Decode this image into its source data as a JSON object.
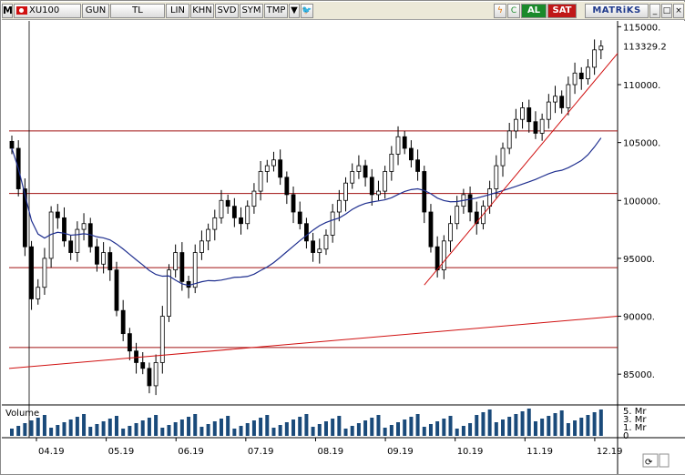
{
  "toolbar": {
    "logo": "M",
    "symbol": "XU100",
    "period": "GUN",
    "currency": "TL",
    "scale_lin": "LIN",
    "btn_khn": "KHN",
    "btn_svd": "SVD",
    "btn_sym": "SYM",
    "btn_tmp": "TMP",
    "buy": "AL",
    "sell": "SAT",
    "brand": "MATRiKS"
  },
  "colors": {
    "candle": "#000000",
    "ma_line": "#1f2f8f",
    "support_lines": "#a01010",
    "trend_line": "#d01010",
    "volume_bars": "#1a4a7a"
  },
  "chart_data": {
    "type": "candlestick",
    "last_price": "113329.2",
    "y_ticks": [
      "115000.",
      "110000.",
      "105000.",
      "100000.",
      "95000.",
      "90000.",
      "85000."
    ],
    "y_values": [
      115000,
      110000,
      105000,
      100000,
      95000,
      90000,
      85000
    ],
    "ylim": [
      82500,
      115500
    ],
    "x_ticks": [
      "04.19",
      "05.19",
      "06.19",
      "07.19",
      "08.19",
      "09.19",
      "10.19",
      "11.19",
      "12.19"
    ],
    "horizontal_levels": [
      106000,
      100600,
      94200,
      87300
    ],
    "volume_label": "Volume",
    "volume_ticks": [
      "5. Mr",
      "3. Mr",
      "1. Mr",
      "0"
    ],
    "closes": [
      104500,
      101000,
      96000,
      91500,
      92500,
      95000,
      99000,
      98500,
      96500,
      95500,
      97500,
      98000,
      96000,
      94500,
      95500,
      94000,
      90500,
      88500,
      87000,
      86000,
      85500,
      84000,
      86000,
      90000,
      94000,
      95500,
      93000,
      92500,
      95500,
      96500,
      97500,
      98500,
      100000,
      99500,
      98500,
      98000,
      99500,
      100800,
      102500,
      103000,
      103500,
      102000,
      100500,
      99000,
      98000,
      96500,
      95500,
      95800,
      97000,
      99000,
      100000,
      101500,
      102500,
      103000,
      102000,
      100500,
      100800,
      102500,
      104000,
      105500,
      104500,
      103500,
      102500,
      99000,
      96000,
      94000,
      96500,
      98000,
      99500,
      100500,
      99000,
      98000,
      99500,
      101000,
      103000,
      104500,
      106000,
      107000,
      108000,
      106800,
      105800,
      107000,
      108500,
      109000,
      108000,
      110000,
      111000,
      110500,
      111500,
      113000,
      113329
    ]
  }
}
